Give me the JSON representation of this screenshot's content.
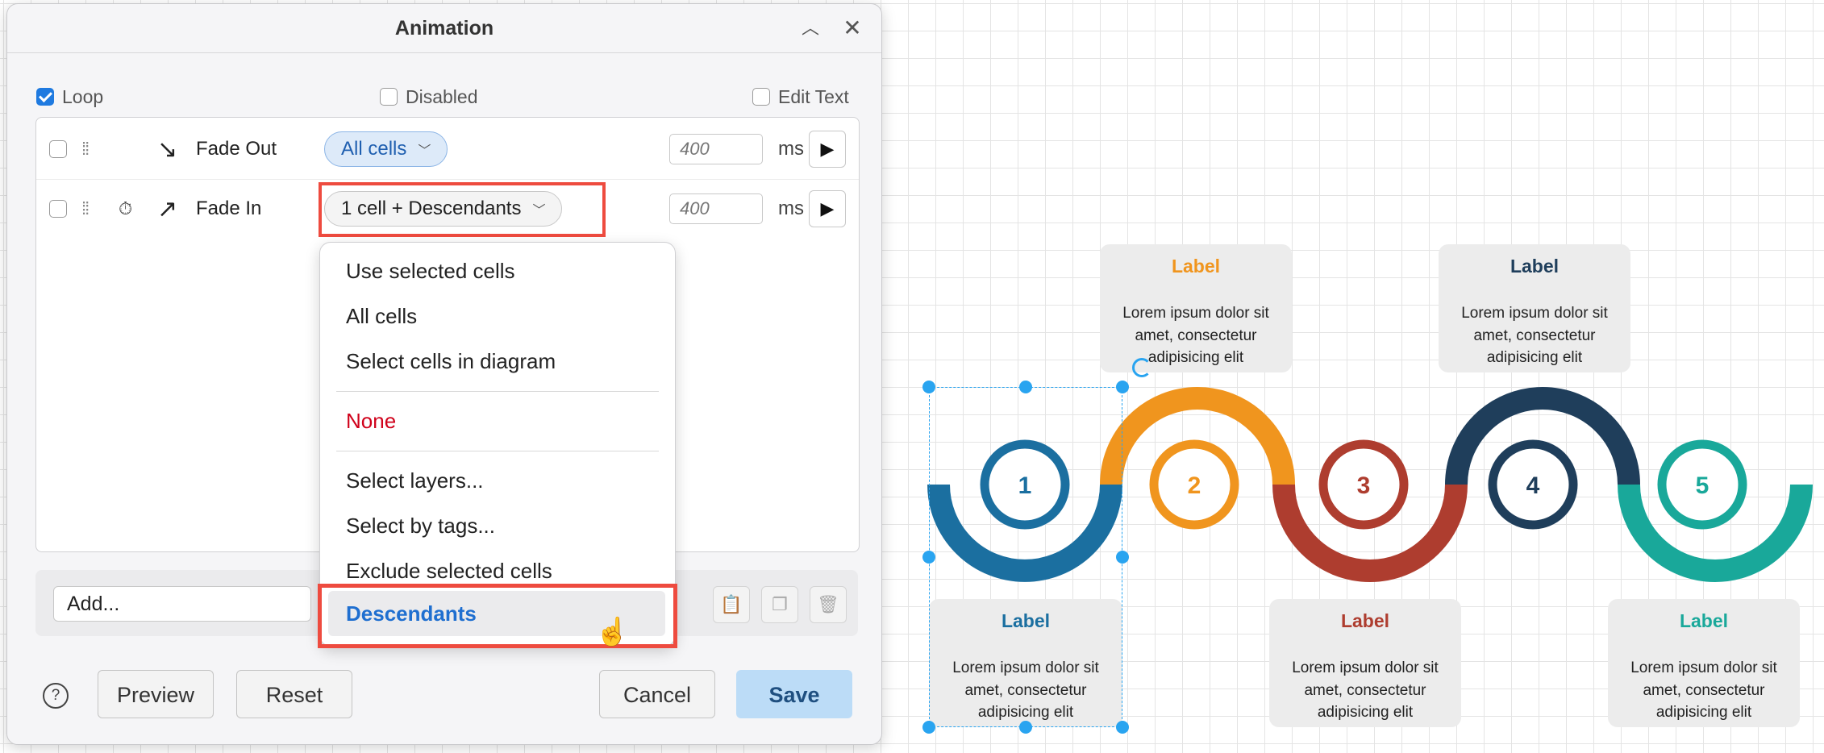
{
  "dialog": {
    "title": "Animation",
    "options": {
      "loop_label": "Loop",
      "loop_checked": true,
      "disabled_label": "Disabled",
      "edit_text_label": "Edit Text"
    },
    "rows": [
      {
        "effect": "Fade Out",
        "arrow": "↘",
        "target": "All cells",
        "duration_placeholder": "400",
        "unit": "ms"
      },
      {
        "effect": "Fade In",
        "arrow": "↗",
        "target": "1 cell + Descendants",
        "duration_placeholder": "400",
        "unit": "ms"
      }
    ],
    "add_label": "Add...",
    "buttons": {
      "preview": "Preview",
      "reset": "Reset",
      "cancel": "Cancel",
      "save": "Save",
      "help": "?"
    }
  },
  "menu": {
    "items": [
      "Use selected cells",
      "All cells",
      "Select cells in diagram",
      "None",
      "Select layers...",
      "Select by tags...",
      "Exclude selected cells",
      "Descendants"
    ],
    "active": "Descendants"
  },
  "diagram": {
    "steps": [
      {
        "num": "1",
        "color": "#1b6fa0"
      },
      {
        "num": "2",
        "color": "#f0951e"
      },
      {
        "num": "3",
        "color": "#ae3d2f"
      },
      {
        "num": "4",
        "color": "#1f3e5b"
      },
      {
        "num": "5",
        "color": "#19a89a"
      }
    ],
    "labels": [
      {
        "title": "Label",
        "text": [
          "Lorem ipsum dolor sit",
          "amet, consectetur",
          "adipisicing elit"
        ],
        "color": "#1b6fa0"
      },
      {
        "title": "Label",
        "text": [
          "Lorem ipsum dolor sit",
          "amet, consectetur",
          "adipisicing elit"
        ],
        "color": "#f0951e"
      },
      {
        "title": "Label",
        "text": [
          "Lorem ipsum dolor sit",
          "amet, consectetur",
          "adipisicing elit"
        ],
        "color": "#ae3d2f"
      },
      {
        "title": "Label",
        "text": [
          "Lorem ipsum dolor sit",
          "amet, consectetur",
          "adipisicing elit"
        ],
        "color": "#1f3e5b"
      },
      {
        "title": "Label",
        "text": [
          "Lorem ipsum dolor sit",
          "amet, consectetur",
          "adipisicing elit"
        ],
        "color": "#19a89a"
      }
    ]
  }
}
